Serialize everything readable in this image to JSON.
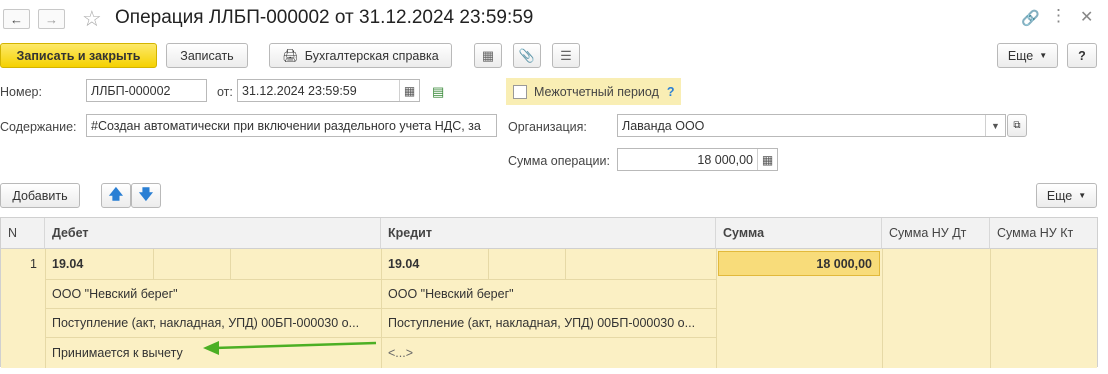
{
  "window": {
    "title": "Операция ЛЛБП-000002 от 31.12.2024 23:59:59"
  },
  "toolbar": {
    "save_close": "Записать и закрыть",
    "save": "Записать",
    "report": "Бухгалтерская справка",
    "more": "Еще",
    "help": "?"
  },
  "form": {
    "number_label": "Номер:",
    "number_value": "ЛЛБП-000002",
    "date_label": "от:",
    "date_value": "31.12.2024 23:59:59",
    "interperiod_label": "Межотчетный период",
    "interperiod_help": "?",
    "content_label": "Содержание:",
    "content_value": "#Создан автоматически при включении раздельного учета НДС, за",
    "org_label": "Организация:",
    "org_value": "Лаванда ООО",
    "sum_label": "Сумма операции:",
    "sum_value": "18 000,00"
  },
  "table_toolbar": {
    "add": "Добавить",
    "more": "Еще"
  },
  "table": {
    "columns": [
      "N",
      "Дебет",
      "Кредит",
      "Сумма",
      "Сумма НУ Дт",
      "Сумма НУ Кт"
    ],
    "rows": [
      {
        "n": "1",
        "debit_account": "19.04",
        "debit_sub1": "ООО \"Невский берег\"",
        "debit_sub2": "Поступление (акт, накладная, УПД) 00БП-000030 о...",
        "debit_sub3": "Принимается к вычету",
        "credit_account": "19.04",
        "credit_sub1": "ООО \"Невский берег\"",
        "credit_sub2": "Поступление (акт, накладная, УПД) 00БП-000030 о...",
        "credit_sub3": "<...>",
        "sum": "18 000,00",
        "sum_nu_dt": "",
        "sum_nu_kt": ""
      }
    ]
  },
  "annotation": {
    "arrow_color": "#4caf24"
  }
}
